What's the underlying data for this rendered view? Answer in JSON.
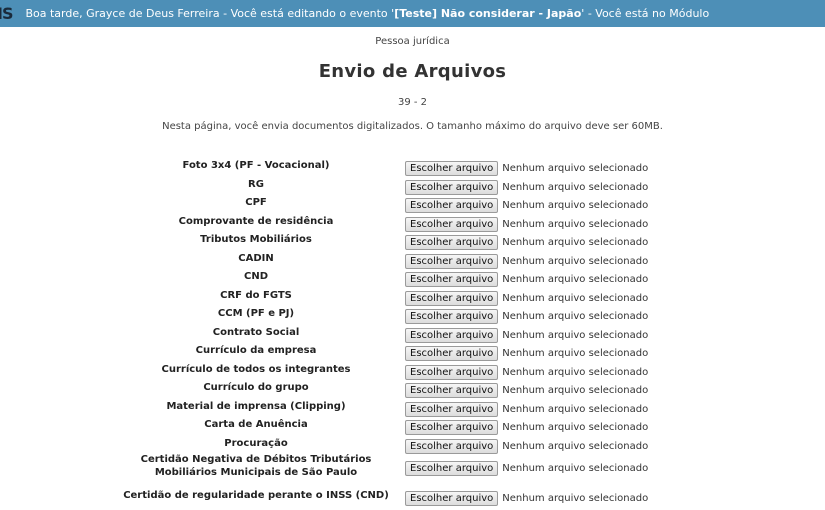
{
  "topbar": {
    "logo": "IS",
    "greeting": "Boa tarde, Grayce de Deus Ferreira - Você está editando o evento '",
    "event": "[Teste] Não considerar - Japão",
    "suffix": "' - Você está no Módulo"
  },
  "page": {
    "subtitle": "Pessoa jurídica",
    "title": "Envio de Arquivos",
    "code": "39 - 2",
    "intro": "Nesta página, você envia documentos digitalizados. O tamanho máximo do arquivo deve ser 60MB."
  },
  "file_button_label": "Escolher arquivo",
  "file_status": "Nenhum arquivo selecionado",
  "documents": [
    "Foto 3x4 (PF - Vocacional)",
    "RG",
    "CPF",
    "Comprovante de residência",
    "Tributos Mobiliários",
    "CADIN",
    "CND",
    "CRF do FGTS",
    "CCM (PF e PJ)",
    "Contrato Social",
    "Currículo da empresa",
    "Currículo de todos os integrantes",
    "Currículo do grupo",
    "Material de imprensa (Clipping)",
    "Carta de Anuência",
    "Procuração",
    "Certidão Negativa de Débitos Tributários Mobiliários Municipais de São Paulo",
    "Certidão de regularidade perante o INSS (CND)"
  ]
}
